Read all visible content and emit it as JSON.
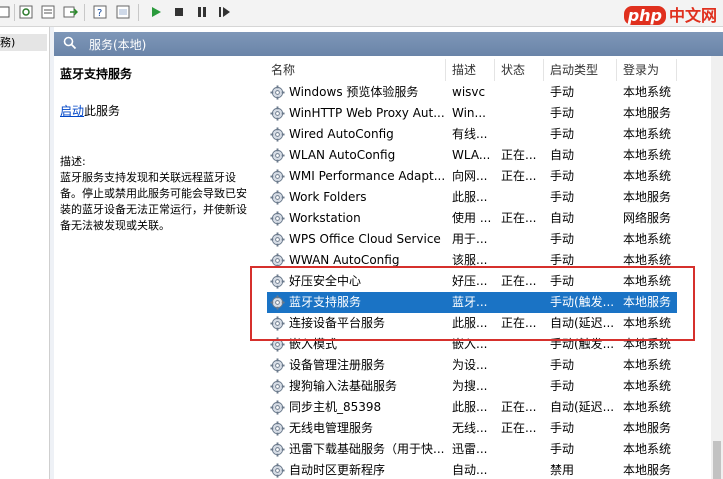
{
  "window": {
    "left_tree_item": "務)",
    "header_title": "服务(本地)",
    "watermark": {
      "brand": "php",
      "text": "中文网"
    }
  },
  "details": {
    "service_name": "蓝牙支持服务",
    "start_link": "启动",
    "start_suffix": "此服务",
    "description_label": "描述:",
    "description": "蓝牙服务支持发现和关联远程蓝牙设备。停止或禁用此服务可能会导致已安装的蓝牙设备无法正常运行，并使新设备无法被发现或关联。"
  },
  "columns": {
    "name": "名称",
    "description": "描述",
    "status": "状态",
    "startup": "启动类型",
    "logon": "登录为"
  },
  "rows": [
    {
      "name": "Windows 预览体验服务",
      "desc": "wisvc",
      "status": "",
      "startup": "手动",
      "logon": "本地系统"
    },
    {
      "name": "WinHTTP Web Proxy Aut...",
      "desc": "Win...",
      "status": "",
      "startup": "手动",
      "logon": "本地服务"
    },
    {
      "name": "Wired AutoConfig",
      "desc": "有线...",
      "status": "",
      "startup": "手动",
      "logon": "本地系统"
    },
    {
      "name": "WLAN AutoConfig",
      "desc": "WLA...",
      "status": "正在...",
      "startup": "自动",
      "logon": "本地系统"
    },
    {
      "name": "WMI Performance Adapt...",
      "desc": "向网...",
      "status": "正在...",
      "startup": "手动",
      "logon": "本地系统"
    },
    {
      "name": "Work Folders",
      "desc": "此服...",
      "status": "",
      "startup": "手动",
      "logon": "本地服务"
    },
    {
      "name": "Workstation",
      "desc": "使用 ...",
      "status": "正在...",
      "startup": "自动",
      "logon": "网络服务"
    },
    {
      "name": "WPS Office Cloud Service",
      "desc": "用于...",
      "status": "",
      "startup": "手动",
      "logon": "本地系统"
    },
    {
      "name": "WWAN AutoConfig",
      "desc": "该服...",
      "status": "",
      "startup": "手动",
      "logon": "本地系统"
    },
    {
      "name": "好压安全中心",
      "desc": "好压...",
      "status": "正在...",
      "startup": "手动",
      "logon": "本地系统"
    },
    {
      "name": "蓝牙支持服务",
      "desc": "蓝牙...",
      "status": "",
      "startup": "手动(触发...",
      "logon": "本地服务",
      "selected": true
    },
    {
      "name": "连接设备平台服务",
      "desc": "此服...",
      "status": "正在...",
      "startup": "自动(延迟...",
      "logon": "本地系统"
    },
    {
      "name": "嵌入模式",
      "desc": "嵌入...",
      "status": "",
      "startup": "手动(触发...",
      "logon": "本地系统"
    },
    {
      "name": "设备管理注册服务",
      "desc": "为设...",
      "status": "",
      "startup": "手动",
      "logon": "本地系统"
    },
    {
      "name": "搜狗输入法基础服务",
      "desc": "为搜...",
      "status": "",
      "startup": "手动",
      "logon": "本地系统"
    },
    {
      "name": "同步主机_85398",
      "desc": "此服...",
      "status": "正在...",
      "startup": "自动(延迟...",
      "logon": "本地系统"
    },
    {
      "name": "无线电管理服务",
      "desc": "无线...",
      "status": "正在...",
      "startup": "手动",
      "logon": "本地服务"
    },
    {
      "name": "迅雷下载基础服务（用于快...",
      "desc": "迅雷...",
      "status": "",
      "startup": "手动",
      "logon": "本地系统"
    },
    {
      "name": "自动时区更新程序",
      "desc": "自动...",
      "status": "",
      "startup": "禁用",
      "logon": "本地服务"
    }
  ],
  "colors": {
    "selection": "#1a73c5",
    "highlight_box": "#d6302c",
    "header_bar": "#7290b4"
  }
}
